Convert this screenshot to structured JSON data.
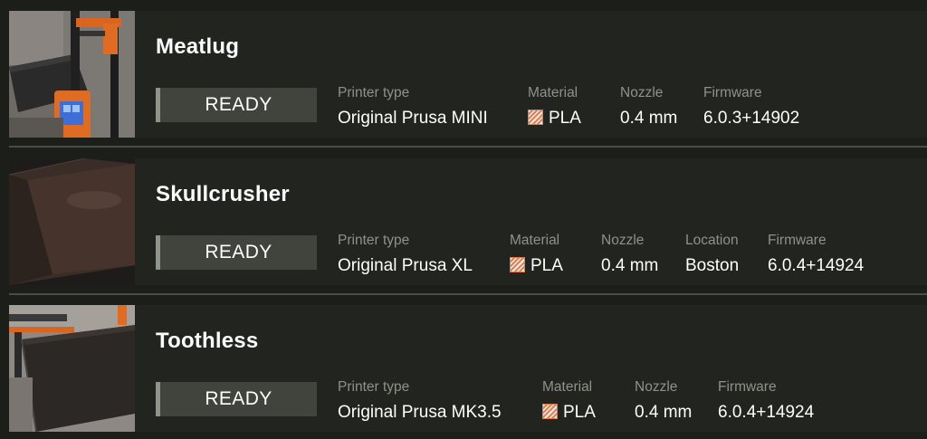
{
  "printers": [
    {
      "name": "Meatlug",
      "status": "READY",
      "printer_type_label": "Printer type",
      "printer_type": "Original Prusa MINI",
      "material_label": "Material",
      "material": "PLA",
      "nozzle_label": "Nozzle",
      "nozzle": "0.4 mm",
      "firmware_label": "Firmware",
      "firmware": "6.0.3+14902",
      "thumbnail_icon": "printer-photo-mini"
    },
    {
      "name": "Skullcrusher",
      "status": "READY",
      "printer_type_label": "Printer type",
      "printer_type": "Original Prusa XL",
      "material_label": "Material",
      "material": "PLA",
      "nozzle_label": "Nozzle",
      "nozzle": "0.4 mm",
      "location_label": "Location",
      "location": "Boston",
      "firmware_label": "Firmware",
      "firmware": "6.0.4+14924",
      "thumbnail_icon": "printer-photo-xl-bed"
    },
    {
      "name": "Toothless",
      "status": "READY",
      "printer_type_label": "Printer type",
      "printer_type": "Original Prusa MK3.5",
      "material_label": "Material",
      "material": "PLA",
      "nozzle_label": "Nozzle",
      "nozzle": "0.4 mm",
      "firmware_label": "Firmware",
      "firmware": "6.0.4+14924",
      "thumbnail_icon": "printer-photo-mk35"
    }
  ],
  "colors": {
    "background": "#1c1e1a",
    "card": "#22241f",
    "status_fill": "#40443c",
    "status_accent": "#8d9488",
    "label": "#8f9289",
    "material_icon": "#e8784a"
  }
}
